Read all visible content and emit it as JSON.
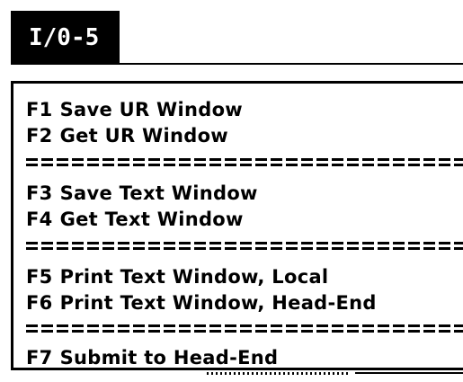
{
  "window": {
    "title": "I/0-5"
  },
  "menu": {
    "items": [
      {
        "key": "F1",
        "label": "Save UR Window"
      },
      {
        "key": "F2",
        "label": "Get UR Window"
      },
      {
        "key": "F3",
        "label": "Save Text Window"
      },
      {
        "key": "F4",
        "label": "Get Text Window"
      },
      {
        "key": "F5",
        "label": "Print Text Window, Local"
      },
      {
        "key": "F6",
        "label": "Print Text Window, Head-End"
      },
      {
        "key": "F7",
        "label": "Submit to Head-End"
      }
    ]
  },
  "colors": {
    "background": "#ffffff",
    "foreground": "#000000",
    "title_bar": "#000000",
    "title_text": "#ffffff"
  }
}
